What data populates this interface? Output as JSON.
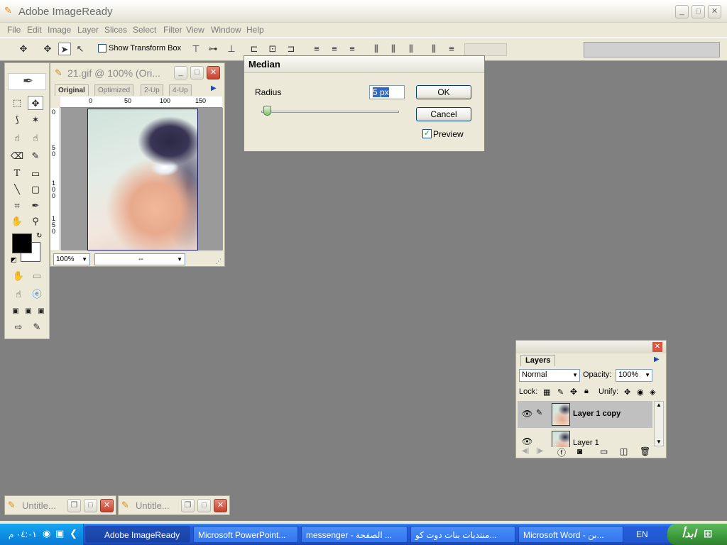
{
  "app": {
    "title": "Adobe ImageReady",
    "window_controls": [
      "_",
      "□",
      "✕"
    ]
  },
  "menu": [
    {
      "label": "File"
    },
    {
      "label": "Edit"
    },
    {
      "label": "Image"
    },
    {
      "label": "Layer"
    },
    {
      "label": "Slices"
    },
    {
      "label": "Select"
    },
    {
      "label": "Filter"
    },
    {
      "label": "View"
    },
    {
      "label": "Window"
    },
    {
      "label": "Help"
    }
  ],
  "options_bar": {
    "show_transform_box_label": "Show Transform Box",
    "show_transform_box_checked": false
  },
  "document": {
    "title": "21.gif @ 100% (Ori...",
    "tabs": [
      "Original",
      "Optimized",
      "2-Up",
      "4-Up"
    ],
    "active_tab": "Original",
    "ruler_h": [
      "0",
      "50",
      "100",
      "150"
    ],
    "ruler_v": [
      "0",
      "5\n0",
      "1\n0\n0",
      "1\n5\n0"
    ],
    "zoom": "100%",
    "status": "--"
  },
  "median_dialog": {
    "title": "Median",
    "radius_label": "Radius",
    "radius_value": "5 px",
    "ok_label": "OK",
    "cancel_label": "Cancel",
    "preview_label": "Preview",
    "preview_checked": true,
    "slider_level": 0.04
  },
  "layers_panel": {
    "tab_label": "Layers",
    "blend_mode": "Normal",
    "opacity_label": "Opacity:",
    "opacity_value": "100%",
    "lock_label": "Lock:",
    "unify_label": "Unify:",
    "layers": [
      {
        "name": "Layer 1 copy",
        "selected": true
      },
      {
        "name": "Layer 1",
        "selected": false
      }
    ]
  },
  "minimized_docs": [
    {
      "title": "Untitle..."
    },
    {
      "title": "Untitle..."
    }
  ],
  "taskbar": {
    "start_label": "ابدأ",
    "language": "EN",
    "clock": "٠٤:٠١ م",
    "buttons": [
      {
        "label": "Adobe ImageReady",
        "active": true
      },
      {
        "label": "Microsoft PowerPoint...",
        "active": false
      },
      {
        "label": "messenger - الصفحة ...",
        "active": false
      },
      {
        "label": "منتديات بنات دوت كو...",
        "active": false
      },
      {
        "label": "Microsoft Word - بن...",
        "active": false
      }
    ]
  },
  "colors": {
    "canvas_bg": "#808080",
    "chrome": "#ECE9D8",
    "taskbar_blue": "#245EDB",
    "start_green": "#3C9A3C"
  }
}
